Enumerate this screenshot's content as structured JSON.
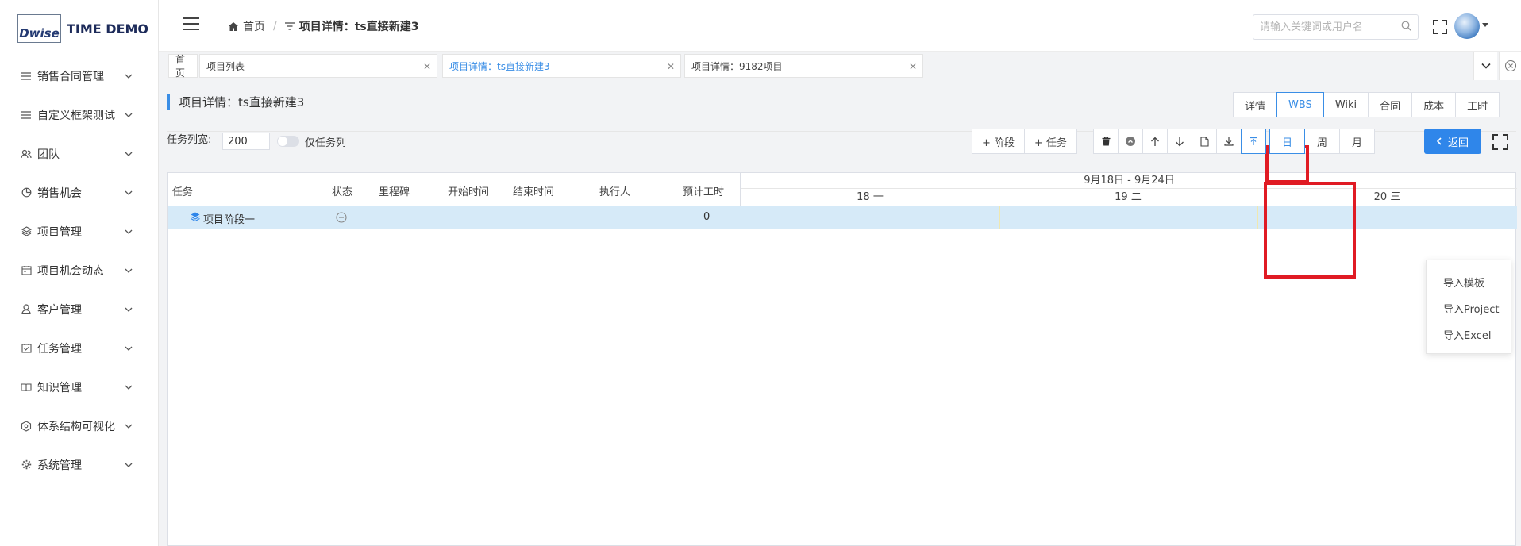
{
  "logo": {
    "mark": "Dwise",
    "text": "TIME DEMO"
  },
  "sidebar": {
    "items": [
      {
        "label": "销售合同管理",
        "icon": "list-icon"
      },
      {
        "label": "自定义框架测试",
        "icon": "list-icon"
      },
      {
        "label": "团队",
        "icon": "team-icon"
      },
      {
        "label": "销售机会",
        "icon": "pie-icon"
      },
      {
        "label": "项目管理",
        "icon": "layers-icon"
      },
      {
        "label": "项目机会动态",
        "icon": "calendar-icon"
      },
      {
        "label": "客户管理",
        "icon": "user-icon"
      },
      {
        "label": "任务管理",
        "icon": "checkbox-icon"
      },
      {
        "label": "知识管理",
        "icon": "book-icon"
      },
      {
        "label": "体系结构可视化",
        "icon": "network-icon"
      },
      {
        "label": "系统管理",
        "icon": "gear-icon"
      }
    ]
  },
  "header": {
    "breadcrumb_home": "首页",
    "breadcrumb_sep": "/",
    "breadcrumb_current": "项目详情：ts直接新建3",
    "search_placeholder": "请输入关键词或用户名"
  },
  "tabs": [
    {
      "label": "首页"
    },
    {
      "label": "项目列表"
    },
    {
      "label": "项目详情：ts直接新建3"
    },
    {
      "label": "项目详情：9182项目"
    }
  ],
  "page": {
    "title": "项目详情：ts直接新建3",
    "top_buttons": [
      "详情",
      "WBS",
      "Wiki",
      "合同",
      "成本",
      "工时"
    ],
    "active_top_button": "WBS"
  },
  "toolbar": {
    "task_width_label": "任务列宽:",
    "task_width_value": "200",
    "only_task_label": "仅任务列",
    "add_stage": "+ 阶段",
    "add_task": "+ 任务",
    "views": [
      "日",
      "周",
      "月"
    ],
    "active_view": "日",
    "back": "返回"
  },
  "grid": {
    "columns": [
      "任务",
      "状态",
      "里程碑",
      "开始时间",
      "结束时间",
      "执行人",
      "预计工时"
    ],
    "week_range": "9月18日 - 9月24日",
    "days": [
      "18 一",
      "19 二",
      "20 三"
    ],
    "rows": [
      {
        "name": "项目阶段一",
        "hours": "0"
      }
    ]
  },
  "import_menu": {
    "items": [
      "导入模板",
      "导入Project",
      "导入Excel"
    ]
  },
  "colors": {
    "accent": "#3a8ee6",
    "highlight": "#e01b24",
    "row_selected": "#d6eaf8"
  }
}
